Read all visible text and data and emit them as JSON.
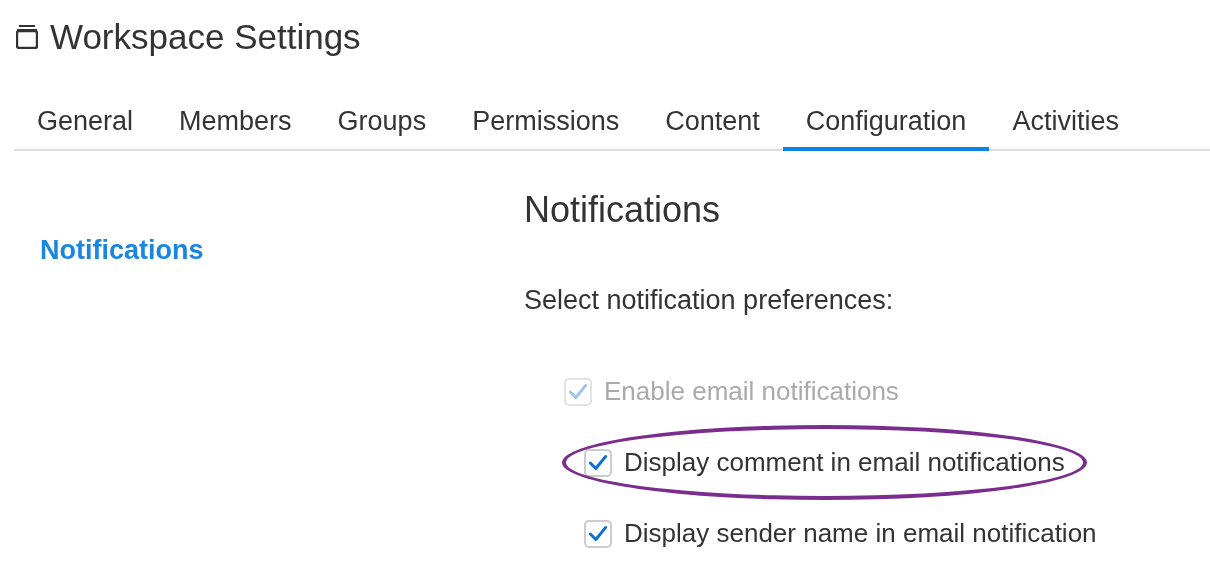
{
  "window": {
    "title": "Workspace Settings"
  },
  "tabs": [
    {
      "label": "General",
      "selected": false
    },
    {
      "label": "Members",
      "selected": false
    },
    {
      "label": "Groups",
      "selected": false
    },
    {
      "label": "Permissions",
      "selected": false
    },
    {
      "label": "Content",
      "selected": false
    },
    {
      "label": "Configuration",
      "selected": true
    },
    {
      "label": "Activities",
      "selected": false
    }
  ],
  "sidebar": {
    "items": [
      {
        "label": "Notifications",
        "selected": true
      }
    ]
  },
  "section": {
    "heading": "Notifications",
    "prompt": "Select notification preferences:",
    "options": [
      {
        "label": "Enable email notifications",
        "checked": true,
        "disabled": true,
        "highlighted": false,
        "children": [
          {
            "label": "Display comment in email notifications",
            "checked": true,
            "disabled": false,
            "highlighted": true
          },
          {
            "label": "Display sender name in email notification",
            "checked": true,
            "disabled": false,
            "highlighted": false
          }
        ]
      }
    ]
  }
}
